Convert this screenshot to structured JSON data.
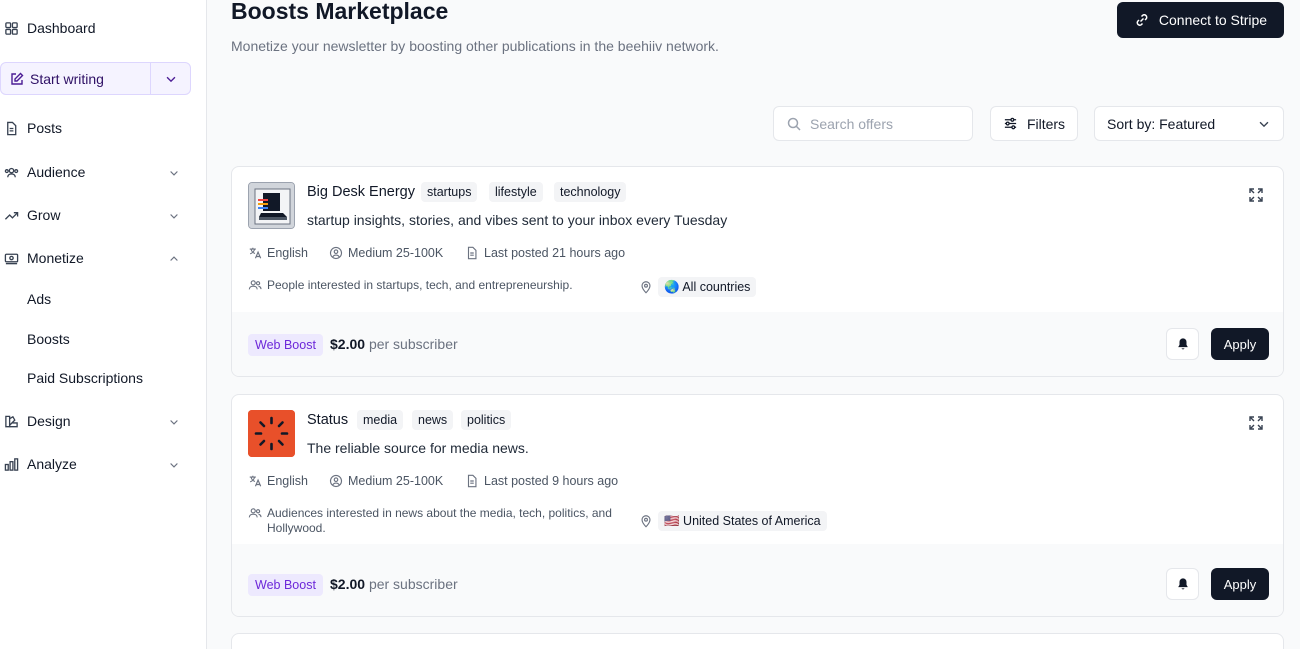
{
  "sidebar": {
    "dashboard": "Dashboard",
    "start_writing": "Start writing",
    "posts": "Posts",
    "audience": "Audience",
    "grow": "Grow",
    "monetize": "Monetize",
    "monetize_items": [
      "Ads",
      "Boosts",
      "Paid Subscriptions"
    ],
    "design": "Design",
    "analyze": "Analyze"
  },
  "header": {
    "title": "Boosts Marketplace",
    "subtitle": "Monetize your newsletter by boosting other publications in the beehiiv network.",
    "stripe_button": "Connect to Stripe"
  },
  "toolbar": {
    "search_placeholder": "Search offers",
    "filters_label": "Filters",
    "sort_label": "Sort by: Featured"
  },
  "offers": [
    {
      "name": "Big Desk Energy",
      "tags": [
        "startups",
        "lifestyle",
        "technology"
      ],
      "description": "startup insights, stories, and vibes sent to your inbox every Tuesday",
      "language": "English",
      "size": "Medium 25-100K",
      "last_posted": "Last posted 21 hours ago",
      "audience": "People interested in startups, tech, and entrepreneurship.",
      "location": "🌏 All countries",
      "badge": "Web Boost",
      "price": "$2.00",
      "price_unit": "per subscriber",
      "apply_label": "Apply"
    },
    {
      "name": "Status",
      "tags": [
        "media",
        "news",
        "politics"
      ],
      "description": "The reliable source for media news.",
      "language": "English",
      "size": "Medium 25-100K",
      "last_posted": "Last posted 9 hours ago",
      "audience": "Audiences interested in news about the media, tech, politics, and Hollywood.",
      "location": "🇺🇸 United States of America",
      "badge": "Web Boost",
      "price": "$2.00",
      "price_unit": "per subscriber",
      "apply_label": "Apply"
    }
  ],
  "colors": {
    "accent_dark": "#111827",
    "boost_badge_bg": "#ede9fe",
    "boost_badge_text": "#6d28d9",
    "status_logo": "#e8502a"
  }
}
